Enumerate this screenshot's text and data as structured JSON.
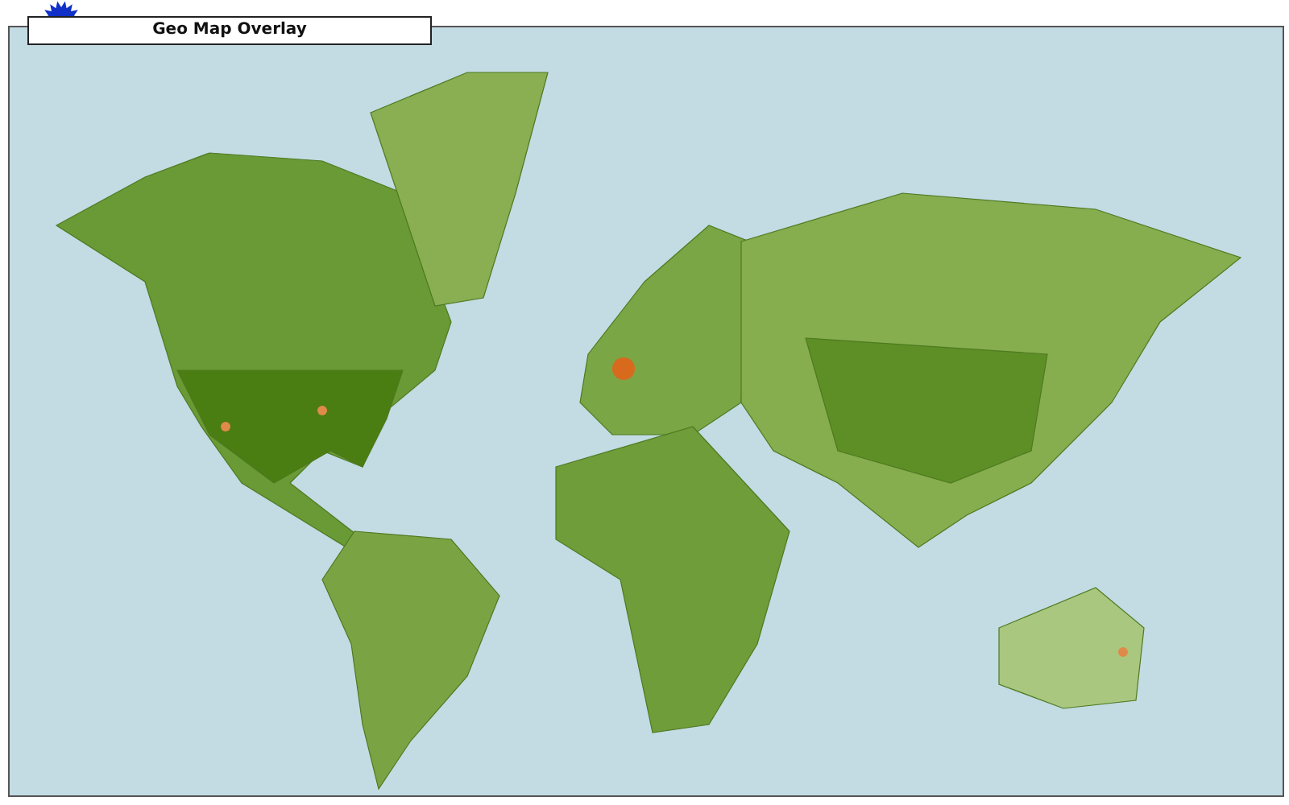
{
  "panel": {
    "title": "Geo Map Overlay"
  }
}
